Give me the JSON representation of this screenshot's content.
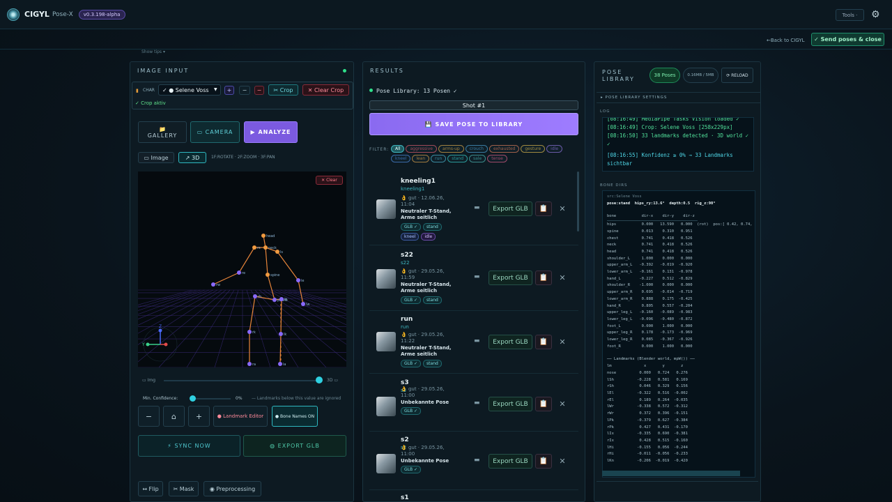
{
  "header": {
    "brand": "CIGYL",
    "subbrand": "Pose-X",
    "version": "v0.3.198-alpha",
    "tools_label": "Tools ·"
  },
  "subbar": {
    "back_label": "←Back to CIGYL",
    "send_label": "✓ Send poses & close",
    "show_tips": "Show tips ▾"
  },
  "image_input": {
    "title": "IMAGE INPUT",
    "char_label": "CHAR",
    "char_select": "✓ ● Selene Voss",
    "plus": "+",
    "minus": "−",
    "remove": "−",
    "crop_label": "✂ Crop",
    "clear_crop_label": "✕ Clear Crop",
    "crop_active": "✓ Crop aktiv",
    "gallery_label": "GALLERY",
    "gallery_icon": "📁",
    "camera_label": "▭ CAMERA",
    "analyze_label": "▶ ANALYZE",
    "image_tab": "▭ Image",
    "tab_3d": "↗ 3D",
    "view_hint": "1F:ROTATE · 2F:ZOOM · 3F:PAN",
    "clear_label": "✕ Clear",
    "slider_left": "▭ Img",
    "slider_right": "3D ▭",
    "confidence_label": "Min. Confidence:",
    "confidence_value": "0%",
    "confidence_note": "— Landmarks below this value are ignored",
    "zoom_out": "−",
    "home": "⌂",
    "zoom_in": "+",
    "landmark_editor": "● Landmark Editor",
    "bone_names": "● Bone Names ON",
    "sync_now": "⚡ SYNC NOW",
    "export_glb": "◍ EXPORT GLB",
    "flip": "↔ Flip",
    "mask": "✂ Mask",
    "preprocessing": "◉ Preprocessing"
  },
  "viewport": {
    "joints": [
      {
        "label": "head"
      },
      {
        "label": "neck"
      },
      {
        "label": "rs"
      },
      {
        "label": "ls"
      },
      {
        "label": "re"
      },
      {
        "label": "le"
      },
      {
        "label": "rw"
      },
      {
        "label": "lw"
      },
      {
        "label": "spine"
      },
      {
        "label": "rh"
      },
      {
        "label": "pelvis"
      },
      {
        "label": "lh"
      },
      {
        "label": "rk"
      },
      {
        "label": "lk"
      },
      {
        "label": "ra"
      },
      {
        "label": "la"
      }
    ],
    "gizmo": {
      "y_label": "Y",
      "z_label": "Z"
    }
  },
  "results": {
    "title": "RESULTS",
    "library_status": "Pose Library: 13 Posen ✓",
    "shot_label": "Shot #1",
    "save_label": "💾 SAVE POSE TO LIBRARY",
    "filter_label": "FILTER:",
    "filters": [
      "All",
      "aggressive",
      "arms-up",
      "crouch",
      "exhausted",
      "gesture",
      "idle",
      "kneel",
      "lean",
      "run",
      "stand",
      "sale",
      "tense"
    ],
    "export_label": "Export GLB",
    "cards": [
      {
        "name": "kneeling1",
        "sub": "kneeling1",
        "meta": "👌 gut · 12.06.26, 11:04",
        "desc": "Neutraler T-Stand, Arme seitlich",
        "tags": [
          "GLB ✓",
          "stand",
          "kneel",
          "idle"
        ]
      },
      {
        "name": "s22",
        "sub": "s22",
        "meta": "👌 gut · 29.05.26, 11:59",
        "desc": "Neutraler T-Stand, Arme seitlich",
        "tags": [
          "GLB ✓",
          "stand"
        ]
      },
      {
        "name": "run",
        "sub": "run",
        "meta": "👌 gut · 29.05.26, 11:22",
        "desc": "Neutraler T-Stand, Arme seitlich",
        "tags": [
          "GLB ✓",
          "stand"
        ]
      },
      {
        "name": "s3",
        "sub": "s3",
        "meta": "👌 gut · 29.05.26, 11:00",
        "desc": "Unbekannte Pose",
        "tags": [
          "GLB ✓"
        ]
      },
      {
        "name": "s2",
        "sub": "s2",
        "meta": "👌 gut · 29.05.26, 11:00",
        "desc": "Unbekannte Pose",
        "tags": [
          "GLB ✓"
        ]
      },
      {
        "name": "s1",
        "sub": "",
        "meta": "",
        "desc": "",
        "tags": []
      }
    ]
  },
  "pose_library": {
    "title_line1": "POSE",
    "title_line2": "LIBRARY",
    "count": "38 Poses",
    "size": "0.16MB / 5MB",
    "reload": "⟳ RELOAD",
    "settings": "▸ POSE LIBRARY SETTINGS",
    "log_label": "LOG",
    "log": [
      {
        "text": "[08:16:49] MediaPipe Tasks Vision loaded ✓",
        "kind": "green"
      },
      {
        "text": "[08:16:49] Crop: Selene Voss [258x229px]",
        "kind": "green"
      },
      {
        "text": "[08:16:50] 33 landmarks detected · 3D world ✓",
        "kind": "green"
      },
      {
        "text": "✓",
        "kind": "green"
      },
      {
        "text": "[08:16:55] Konfidenz ≥ 0% → 33 Landmarks",
        "kind": "cyan"
      },
      {
        "text": "sichtbar",
        "kind": "cyan"
      }
    ],
    "bone_dirs_label": "BONE DIRS",
    "bone_header": "src:Selene Voss",
    "bone_summary": "pose:stand  hips_ry:13.6°  depth:0.5  rig_z:90°",
    "bone_columns": "bone           dir-x    dir-y    dir-z",
    "bones": [
      "hips           0.000   13.590   0.000  (rot)  pos:[ 0.42, 0.74,",
      "spine          0.013    0.310   0.951",
      "chest          0.741    0.418   0.526",
      "neck           0.741    0.418   0.526",
      "head           0.741    0.418   0.526",
      "shoulder_L     1.000    0.000   0.000",
      "upper_arm_L   -0.392   -0.019  -0.920",
      "lower_arm_L   -0.161    0.131  -0.978",
      "hand_L        -0.227    0.512  -0.829",
      "shoulder_R    -1.000    0.000   0.000",
      "upper_arm_R    0.695   -0.014  -0.719",
      "lower_arm_R    0.888    0.175  -0.425",
      "hand_R         0.805    0.557  -0.204",
      "upper_leg_L   -0.160   -0.089  -0.983",
      "lower_leg_L   -0.096   -0.480  -0.872",
      "foot_L         0.000    1.000   0.000",
      "upper_leg_R    0.178   -0.173  -0.969",
      "lower_leg_R    0.085   -0.367  -0.926",
      "foot_R         0.000    1.000   0.000"
    ],
    "landmarks_header": "── Landmarks (Blender world, mpW()) ──",
    "landmarks_columns": "lm              x       y       z",
    "landmarks": [
      "nose          0.000   0.724   0.276",
      "lSh          -0.228   0.581   0.169",
      "rSh           0.046   0.329   0.156",
      "lEl          -0.322   0.516  -0.002",
      "rEl           0.189   0.264  -0.035",
      "lWr          -0.338   0.572  -0.312",
      "rWr           0.372   0.396  -0.151",
      "lPk          -0.379   0.627  -0.384",
      "rPk           0.427   0.431  -0.170",
      "lIx          -0.335   0.690  -0.381",
      "rIx           0.428   0.515  -0.160",
      "lHi          -0.155   0.056  -0.244",
      "rHi          -0.011  -0.056  -0.233",
      "lKn          -0.206  -0.019  -0.420"
    ]
  }
}
